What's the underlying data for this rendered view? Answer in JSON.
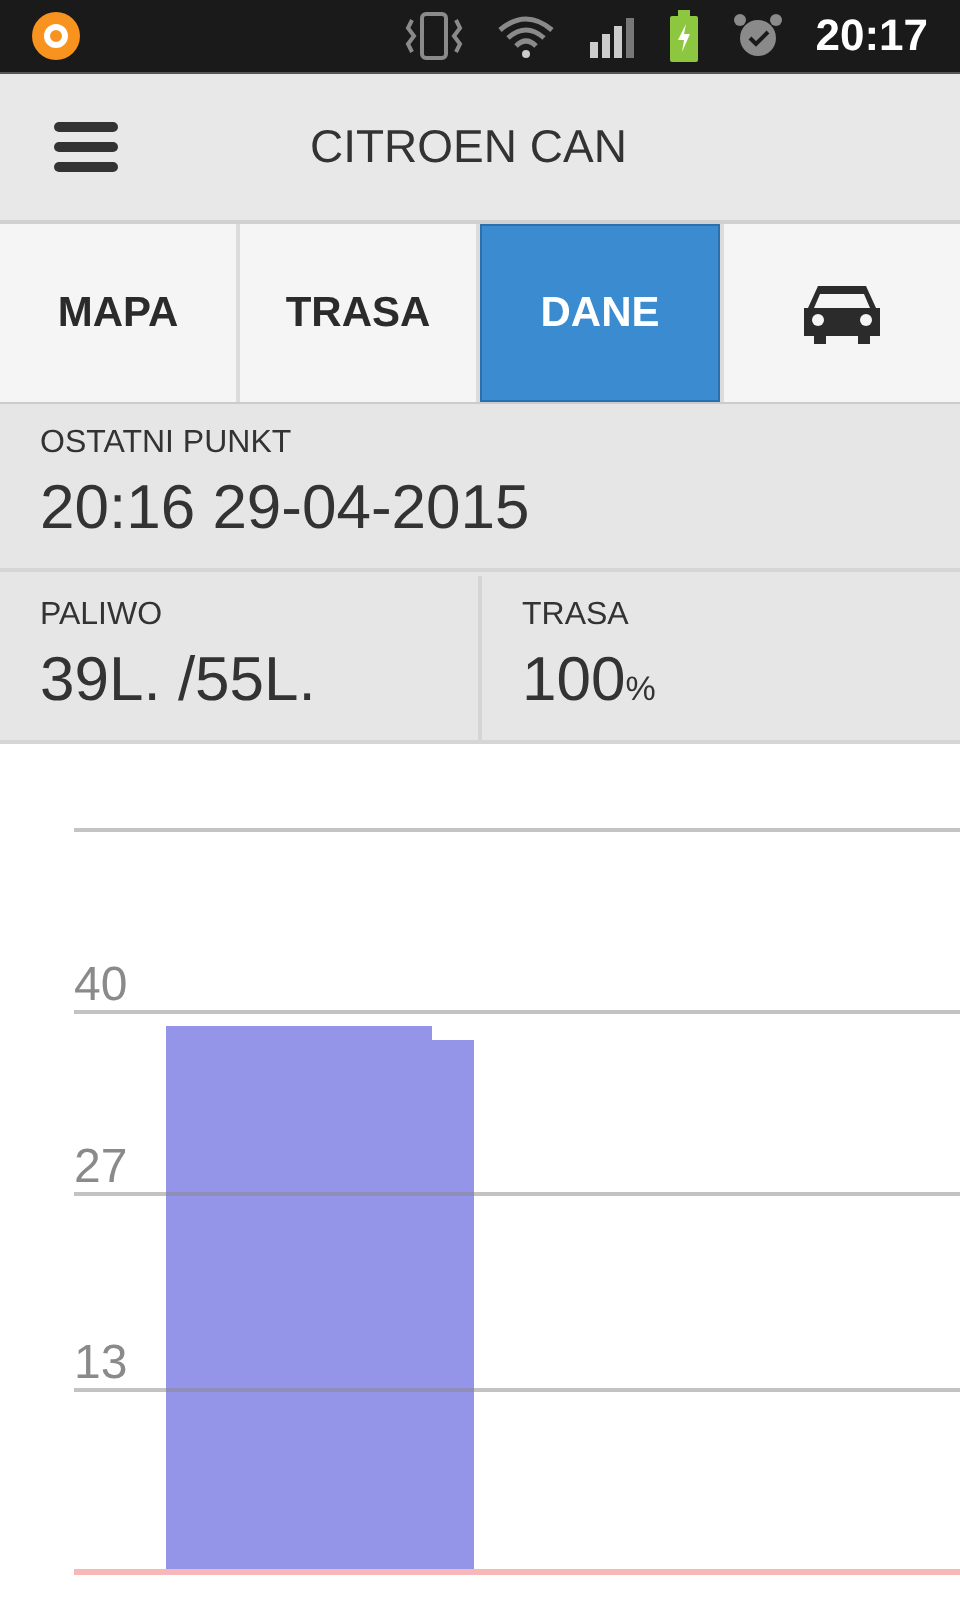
{
  "status_bar": {
    "time": "20:17"
  },
  "header": {
    "title": "CITROEN CAN"
  },
  "tabs": [
    {
      "kind": "text",
      "label": "MAPA",
      "selected": false
    },
    {
      "kind": "text",
      "label": "TRASA",
      "selected": false
    },
    {
      "kind": "text",
      "label": "DANE",
      "selected": true
    },
    {
      "kind": "car",
      "selected": false
    }
  ],
  "last_point": {
    "label": "OSTATNI PUNKT",
    "value": "20:16 29-04-2015"
  },
  "stats": [
    {
      "label": "PALIWO",
      "value": "39L. /55L."
    },
    {
      "label": "TRASA",
      "value": "100",
      "unit": "%"
    }
  ],
  "chart": {
    "chart_data": {
      "type": "bar",
      "grid": true,
      "ylim": [
        0,
        53
      ],
      "yticks": [
        13,
        27,
        40
      ],
      "series": [
        {
          "color": "#9494e8",
          "values": [
            39
          ]
        }
      ]
    }
  }
}
